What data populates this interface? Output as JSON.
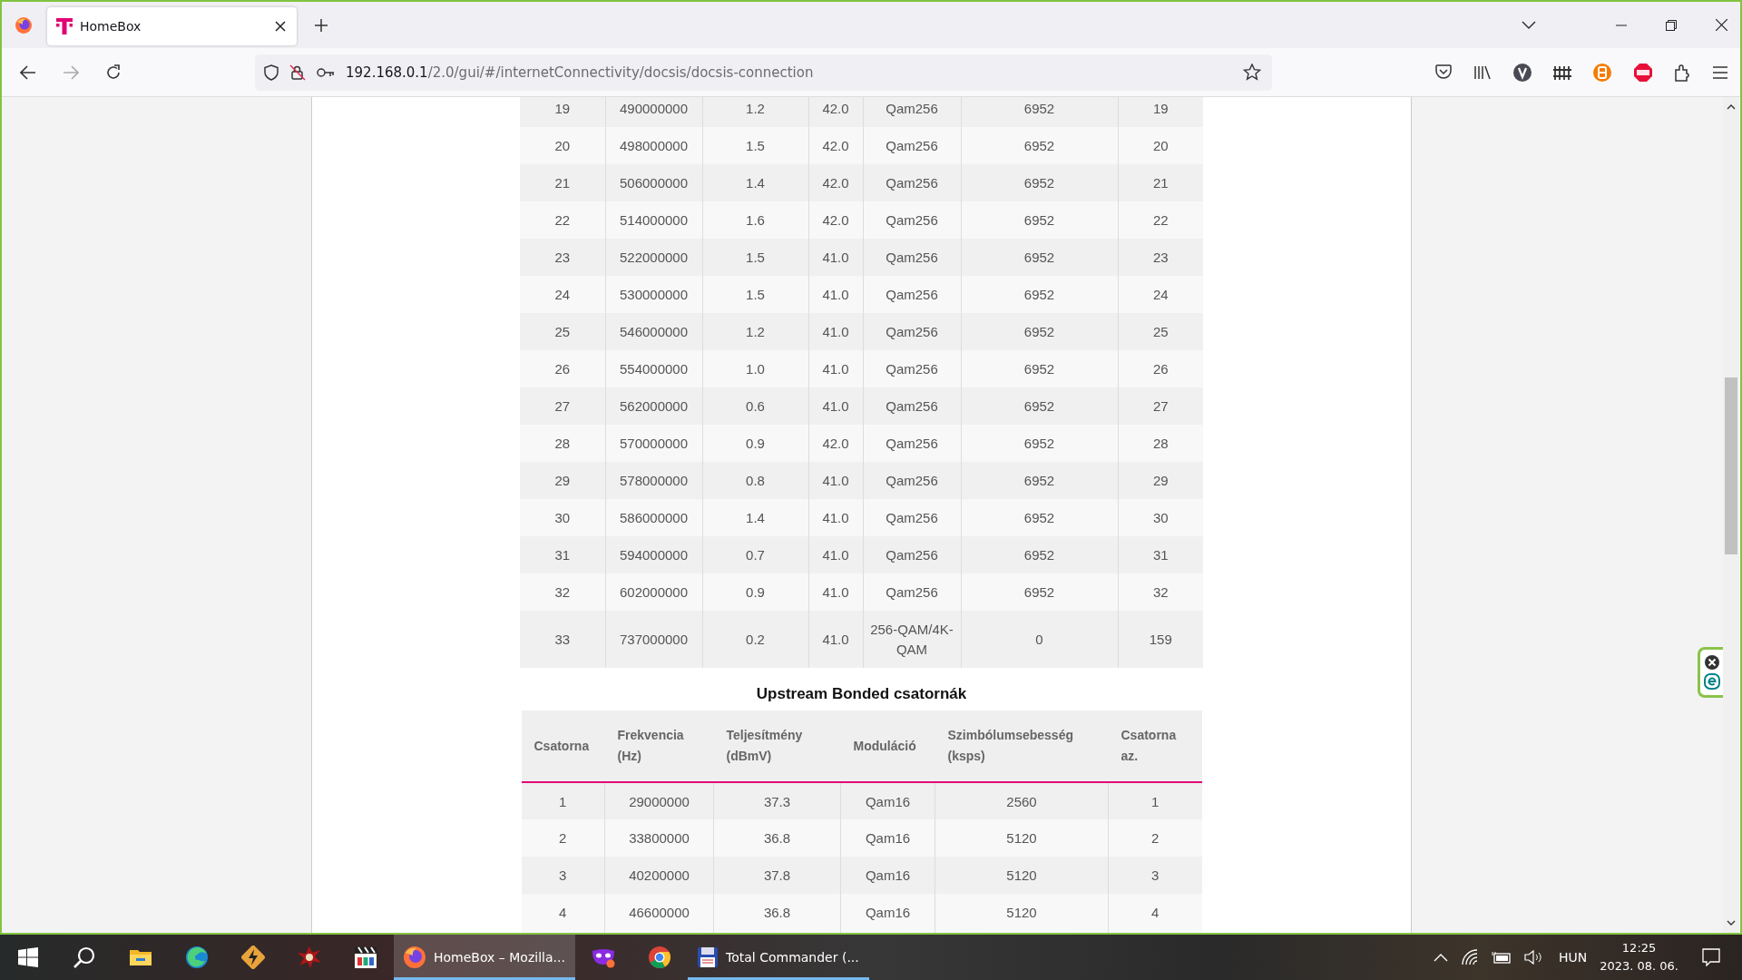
{
  "browser": {
    "tabs": [
      {
        "title": "HomeBox",
        "selected": true
      }
    ],
    "address": {
      "host": "192.168.0.1",
      "path": "/2.0/gui/#/internetConnectivity/docsis/docsis-connection"
    }
  },
  "downstream_table": {
    "rows": [
      [
        "19",
        "490000000",
        "1.2",
        "42.0",
        "Qam256",
        "6952",
        "19"
      ],
      [
        "20",
        "498000000",
        "1.5",
        "42.0",
        "Qam256",
        "6952",
        "20"
      ],
      [
        "21",
        "506000000",
        "1.4",
        "42.0",
        "Qam256",
        "6952",
        "21"
      ],
      [
        "22",
        "514000000",
        "1.6",
        "42.0",
        "Qam256",
        "6952",
        "22"
      ],
      [
        "23",
        "522000000",
        "1.5",
        "41.0",
        "Qam256",
        "6952",
        "23"
      ],
      [
        "24",
        "530000000",
        "1.5",
        "41.0",
        "Qam256",
        "6952",
        "24"
      ],
      [
        "25",
        "546000000",
        "1.2",
        "41.0",
        "Qam256",
        "6952",
        "25"
      ],
      [
        "26",
        "554000000",
        "1.0",
        "41.0",
        "Qam256",
        "6952",
        "26"
      ],
      [
        "27",
        "562000000",
        "0.6",
        "41.0",
        "Qam256",
        "6952",
        "27"
      ],
      [
        "28",
        "570000000",
        "0.9",
        "42.0",
        "Qam256",
        "6952",
        "28"
      ],
      [
        "29",
        "578000000",
        "0.8",
        "41.0",
        "Qam256",
        "6952",
        "29"
      ],
      [
        "30",
        "586000000",
        "1.4",
        "41.0",
        "Qam256",
        "6952",
        "30"
      ],
      [
        "31",
        "594000000",
        "0.7",
        "41.0",
        "Qam256",
        "6952",
        "31"
      ],
      [
        "32",
        "602000000",
        "0.9",
        "41.0",
        "Qam256",
        "6952",
        "32"
      ],
      [
        "33",
        "737000000",
        "0.2",
        "41.0",
        "256-QAM/4K-QAM",
        "0",
        "159"
      ]
    ]
  },
  "upstream_table": {
    "title": "Upstream Bonded csatornák",
    "columns": [
      "Csatorna",
      "Frekvencia (Hz)",
      "Teljesítmény (dBmV)",
      "Moduláció",
      "Szimbólumsebesség (ksps)",
      "Csatorna az."
    ],
    "rows": [
      [
        "1",
        "29000000",
        "37.3",
        "Qam16",
        "2560",
        "1"
      ],
      [
        "2",
        "33800000",
        "36.8",
        "Qam16",
        "5120",
        "2"
      ],
      [
        "3",
        "40200000",
        "37.8",
        "Qam16",
        "5120",
        "3"
      ],
      [
        "4",
        "46600000",
        "36.8",
        "Qam16",
        "5120",
        "4"
      ]
    ]
  },
  "taskbar": {
    "windows": [
      {
        "label": "HomeBox – Mozilla...",
        "selected": true
      },
      {
        "label": "Total Commander (...",
        "selected": false
      }
    ],
    "language": "HUN",
    "time": "12:25",
    "date": "2023. 08. 06."
  }
}
